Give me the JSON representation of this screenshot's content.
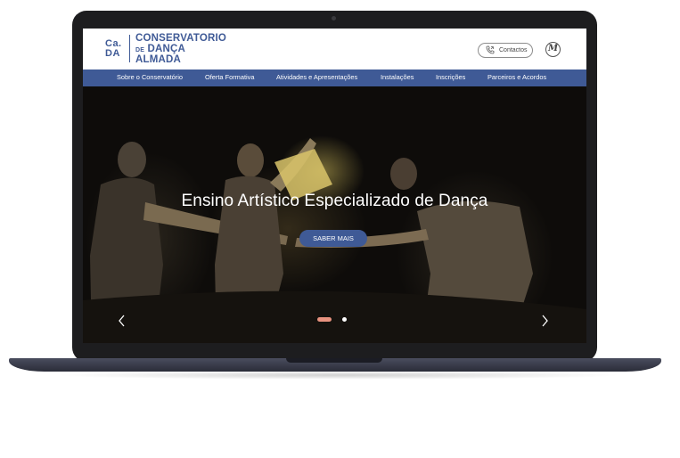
{
  "brand": {
    "mark_line1": "Ca.",
    "mark_line2": "DA",
    "name_line1": "CONSERVATORIO",
    "name_line2": "DANÇA",
    "name_line3": "ALMADA",
    "name_prefix": "DE",
    "color": "#3f5a96"
  },
  "header": {
    "contact_label": "Contactos",
    "partner_logo": "M"
  },
  "nav": {
    "items": [
      {
        "label": "Sobre o Conservatório"
      },
      {
        "label": "Oferta Formativa"
      },
      {
        "label": "Atividades e Apresentações"
      },
      {
        "label": "Instalações"
      },
      {
        "label": "Inscrições"
      },
      {
        "label": "Parceiros e Acordos"
      }
    ]
  },
  "hero": {
    "title": "Ensino Artístico Especializado de Dança",
    "cta_label": "SABER MAIS",
    "slides_total": 2,
    "active_slide": 1,
    "accent_active_dot": "#e8927f"
  },
  "icons": {
    "phone": "phone-icon",
    "prev": "chevron-left-icon",
    "next": "chevron-right-icon"
  }
}
